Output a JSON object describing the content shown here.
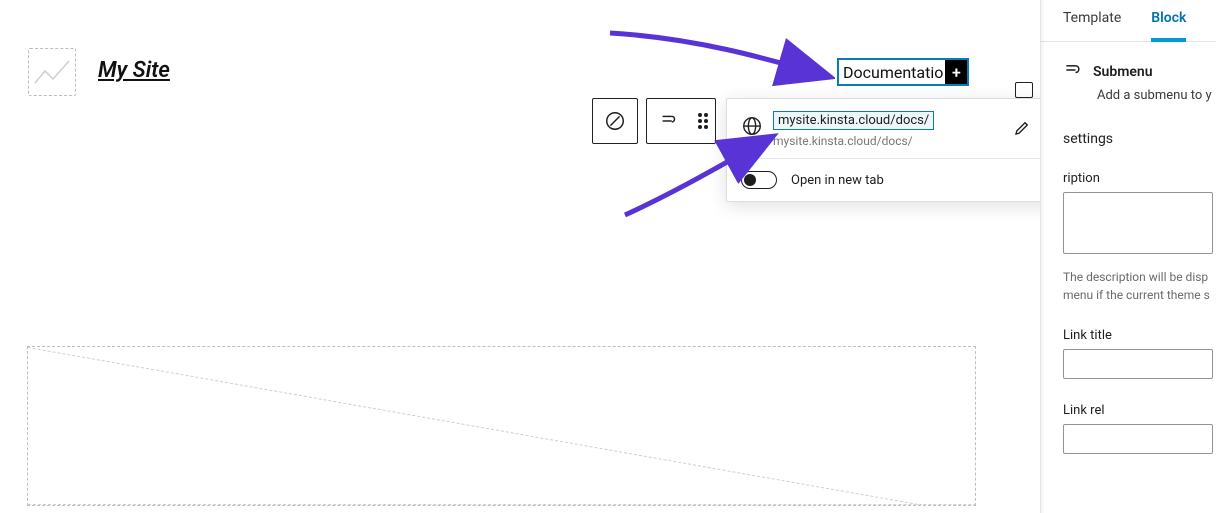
{
  "site": {
    "title": "My Site"
  },
  "nav": {
    "item_label": "Documentatio",
    "plus_glyph": "+"
  },
  "link_popover": {
    "url_display": "mysite.kinsta.cloud/docs/",
    "url_secondary": "mysite.kinsta.cloud/docs/",
    "open_new_tab_label": "Open in new tab"
  },
  "sidebar": {
    "tabs": {
      "template": "Template",
      "block": "Block"
    },
    "block_name": "Submenu",
    "block_desc": "Add a submenu to y",
    "settings_heading": "settings",
    "description_label": "ription",
    "description_value": "",
    "description_help1": "The description will be disp",
    "description_help2": "menu if the current theme s",
    "link_title_label": "Link title",
    "link_title_value": "",
    "link_rel_label": "Link rel",
    "link_rel_value": ""
  }
}
